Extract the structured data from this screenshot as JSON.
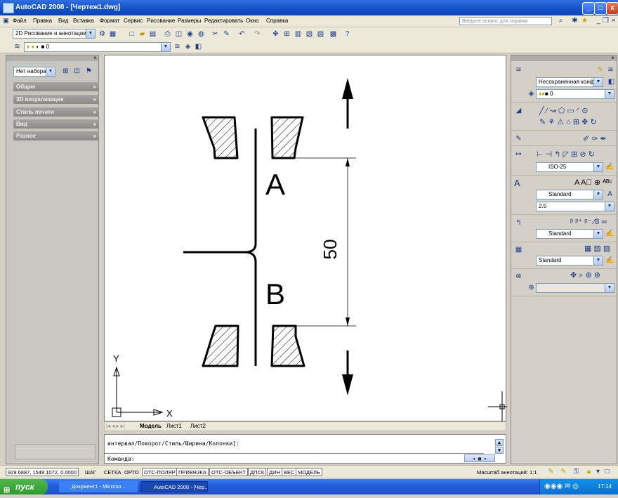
{
  "window": {
    "title": "AutoCAD 2008 - [Чертеж1.dwg]",
    "controls": [
      "_",
      "□",
      "x"
    ]
  },
  "menu": {
    "items": [
      "Файл",
      "Правка",
      "Вид",
      "Вставка",
      "Формат",
      "Сервис",
      "Рисование",
      "Размеры",
      "Редактировать",
      "Окно",
      "Справка"
    ],
    "help_placeholder": "Введите вопрос для справки"
  },
  "toolbar": {
    "workspace": "2D Рисование и аннотации",
    "layer": "0"
  },
  "left_panel": {
    "selection_set": "Нет набора",
    "sections": [
      "Общие",
      "3D визуализация",
      "Стиль печати",
      "Вид",
      "Разное"
    ]
  },
  "drawing": {
    "label_a": "A",
    "label_b": "B",
    "dimension": "50",
    "ucs_x": "X",
    "ucs_y": "Y"
  },
  "layout_tabs": {
    "items": [
      "Модель",
      "Лист1",
      "Лист2"
    ]
  },
  "command": {
    "history": "интервал/Поворот/Стиль/Ширина/Колонки]:",
    "prompt": "Команда:"
  },
  "right_panel": {
    "layer_config": "Несохраненная конфи",
    "layer": "0",
    "dim_style": "ISO-25",
    "text_style": "Standard",
    "text_height": "2.5",
    "mleader_style": "Standard",
    "table_style": "Standard"
  },
  "status_bar": {
    "coords": "929.6887, 1548.1072, 0.0000",
    "modes": [
      "ШАГ",
      "СЕТКА",
      "ОРТО",
      "ОТС-ПОЛЯР",
      "ПРИВЯЗКА",
      "ОТС-ОБЪЕКТ",
      "ДПСК",
      "ДИН",
      "ВЕС",
      "МОДЕЛЬ"
    ],
    "annotation_scale": "Масштаб аннотаций: 1:1"
  },
  "taskbar": {
    "start": "пуск",
    "items": [
      "Документ1 - Microso...",
      "AutoCAD 2008 - [Чер..."
    ],
    "clock": "17:14"
  },
  "colors": {
    "title_blue": "#1150c8",
    "start_green": "#2f9a2d",
    "drawing_bg": "#ffffff"
  }
}
